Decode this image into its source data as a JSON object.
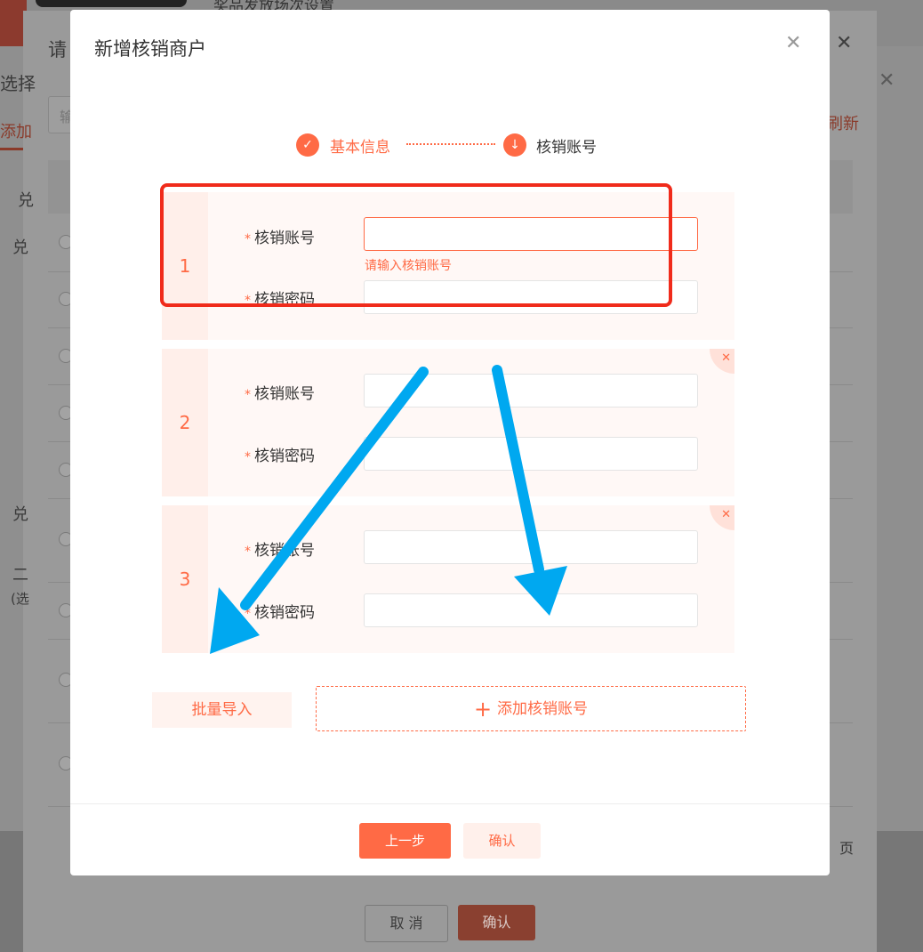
{
  "background": {
    "top_title": "奖品发放场次设置",
    "dialog_title_fragment": "请",
    "select_label": "选择",
    "tab_label": "添加",
    "search_fragment": "输",
    "refresh_label": "刷新",
    "left_labels": [
      "兑",
      "兑",
      "兑",
      "二"
    ],
    "left_sub_label": "(选",
    "page_label": "页",
    "cancel_label": "取 消",
    "confirm_label": "确认"
  },
  "modal": {
    "title": "新增核销商户",
    "close_icon": "close-icon",
    "steps": [
      {
        "label": "基本信息",
        "status": "done",
        "icon": "check-icon"
      },
      {
        "label": "核销账号",
        "status": "current",
        "icon": "arrow-down-icon"
      }
    ],
    "account_groups": [
      {
        "index": "1",
        "account_label": "核销账号",
        "password_label": "核销密码",
        "account_value": "",
        "password_value": "",
        "error": "请输入核销账号",
        "deletable": false
      },
      {
        "index": "2",
        "account_label": "核销账号",
        "password_label": "核销密码",
        "account_value": "",
        "password_value": "",
        "error": "",
        "deletable": true
      },
      {
        "index": "3",
        "account_label": "核销账号",
        "password_label": "核销密码",
        "account_value": "",
        "password_value": "",
        "error": "",
        "deletable": true
      }
    ],
    "required_mark": "*",
    "batch_import_label": "批量导入",
    "add_account_label": "添加核销账号",
    "add_icon": "plus-icon",
    "prev_label": "上一步",
    "confirm_label": "确认"
  },
  "colors": {
    "accent": "#ff6a45",
    "annotation_box": "#f02b1b",
    "annotation_arrow": "#00a8f0"
  }
}
